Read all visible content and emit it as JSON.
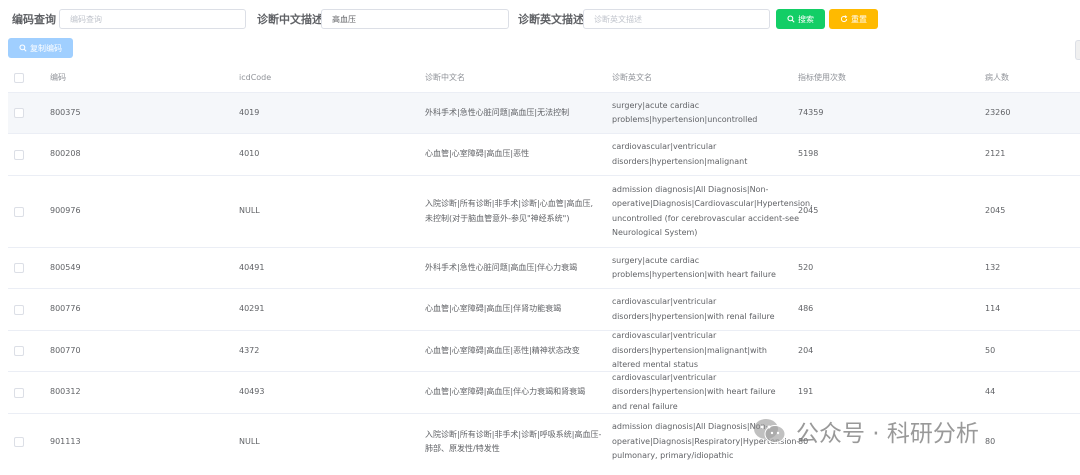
{
  "search": {
    "code_label": "编码查询",
    "code_placeholder": "编码查询",
    "cn_label": "诊断中文描述",
    "cn_value": "高血压",
    "en_label": "诊断英文描述",
    "en_placeholder": "诊断英文描述",
    "search_button": "搜索",
    "reset_button": "重置",
    "copy_button": "复制编码"
  },
  "table": {
    "headers": [
      "编码",
      "icdCode",
      "诊断中文名",
      "诊断英文名",
      "指标使用次数",
      "病人数"
    ],
    "rows": [
      {
        "code": "800375",
        "icd": "4019",
        "cn": "外科手术|急性心脏问题|高血压|无法控制",
        "en": "surgery|acute cardiac problems|hypertension|uncontrolled",
        "uses": "74359",
        "patients": "23260"
      },
      {
        "code": "800208",
        "icd": "4010",
        "cn": "心血管|心室障碍|高血压|恶性",
        "en": "cardiovascular|ventricular disorders|hypertension|malignant",
        "uses": "5198",
        "patients": "2121"
      },
      {
        "code": "900976",
        "icd": "NULL",
        "cn": "入院诊断|所有诊断|非手术|诊断|心血管|高血压, 未控制(对于脑血管意外-参见\"神经系统\")",
        "en": "admission diagnosis|All Diagnosis|Non-operative|Diagnosis|Cardiovascular|Hypertension, uncontrolled (for cerebrovascular accident-see Neurological System)",
        "uses": "2045",
        "patients": "2045"
      },
      {
        "code": "800549",
        "icd": "40491",
        "cn": "外科手术|急性心脏问题|高血压|伴心力衰竭",
        "en": "surgery|acute cardiac problems|hypertension|with heart failure",
        "uses": "520",
        "patients": "132"
      },
      {
        "code": "800776",
        "icd": "40291",
        "cn": "心血管|心室障碍|高血压|伴肾功能衰竭",
        "en": "cardiovascular|ventricular disorders|hypertension|with renal failure",
        "uses": "486",
        "patients": "114"
      },
      {
        "code": "800770",
        "icd": "4372",
        "cn": "心血管|心室障碍|高血压|恶性|精神状态改变",
        "en": "cardiovascular|ventricular disorders|hypertension|malignant|with altered mental status",
        "uses": "204",
        "patients": "50"
      },
      {
        "code": "800312",
        "icd": "40493",
        "cn": "心血管|心室障碍|高血压|伴心力衰竭和肾衰竭",
        "en": "cardiovascular|ventricular disorders|hypertension|with heart failure and renal failure",
        "uses": "191",
        "patients": "44"
      },
      {
        "code": "901113",
        "icd": "NULL",
        "cn": "入院诊断|所有诊断|非手术|诊断|呼吸系统|高血压-肺部、原发性/特发性",
        "en": "admission diagnosis|All Diagnosis|Non-operative|Diagnosis|Respiratory|Hypertension-pulmonary, primary/idiopathic",
        "uses": "80",
        "patients": "80"
      }
    ]
  },
  "watermark": {
    "text": "公众号 · 科研分析"
  },
  "colors": {
    "search": "#13ce66",
    "reset": "#ffba00",
    "copy": "#a0cfff",
    "hover_row": "#f5f7fa"
  }
}
